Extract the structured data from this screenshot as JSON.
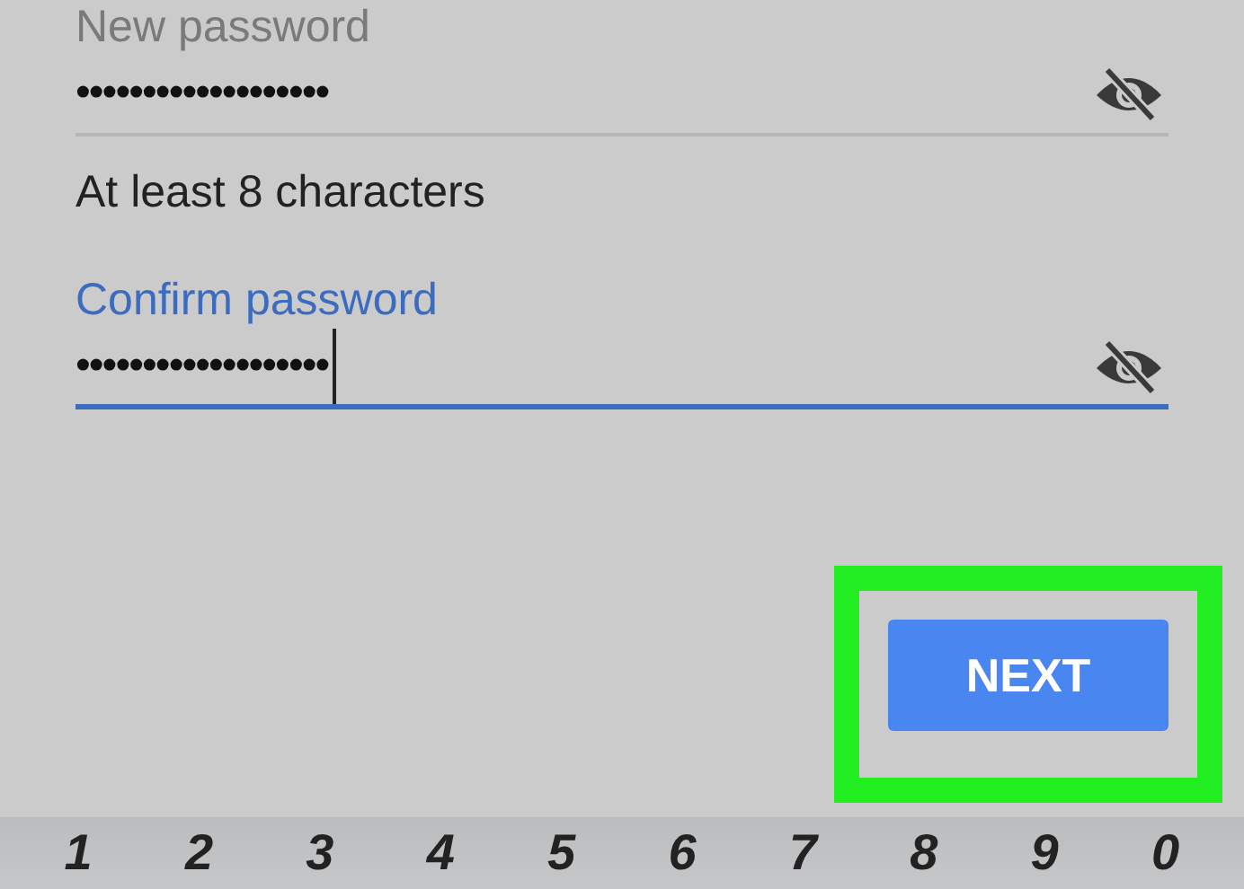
{
  "fields": [
    {
      "label": "New password",
      "value": "•••••••••••••••••••",
      "focused": false,
      "helper": "At least 8 characters"
    },
    {
      "label": "Confirm password",
      "value": "•••••••••••••••••••",
      "focused": true
    }
  ],
  "next_button": {
    "label": "NEXT",
    "highlighted": true
  },
  "keyboard": {
    "keys": [
      "1",
      "2",
      "3",
      "4",
      "5",
      "6",
      "7",
      "8",
      "9",
      "0"
    ]
  }
}
